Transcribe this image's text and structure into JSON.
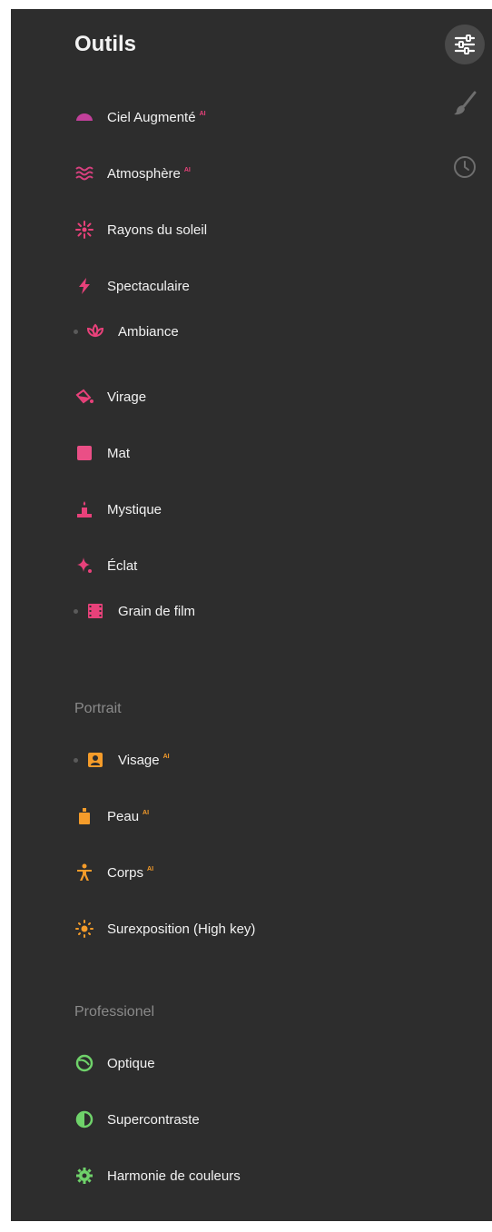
{
  "title": "Outils",
  "colors": {
    "panel_bg": "#2d2d2d",
    "creative": "#e8417a",
    "creative_purple": "#c2409a",
    "portrait": "#f59c2a",
    "professional": "#6fd26a",
    "ai_badge": "#e8417a",
    "sidebar_icon": "#6e6e6e"
  },
  "side_toolbar": [
    {
      "icon": "sliders-icon",
      "active": true
    },
    {
      "icon": "brush-icon",
      "active": false
    },
    {
      "icon": "history-clock-icon",
      "active": false
    }
  ],
  "creative_items": [
    {
      "label": "Ciel Augmenté",
      "ai": "AI",
      "icon": "sky-dome-icon"
    },
    {
      "label": "Atmosphère",
      "ai": "AI",
      "icon": "waves-icon"
    },
    {
      "label": "Rayons du soleil",
      "icon": "sun-rays-icon"
    },
    {
      "label": "Spectaculaire",
      "icon": "lightning-icon"
    },
    {
      "label": "Ambiance",
      "icon": "lotus-icon"
    },
    {
      "label": "Virage",
      "icon": "paint-bucket-icon"
    },
    {
      "label": "Mat",
      "icon": "square-icon"
    },
    {
      "label": "Mystique",
      "icon": "candle-icon"
    },
    {
      "label": "Éclat",
      "icon": "sparkle-icon"
    },
    {
      "label": "Grain de film",
      "icon": "film-icon"
    }
  ],
  "portrait_section": {
    "title": "Portrait",
    "items": [
      {
        "label": "Visage",
        "ai": "AI",
        "icon": "face-frame-icon"
      },
      {
        "label": "Peau",
        "ai": "AI",
        "icon": "bottle-icon"
      },
      {
        "label": "Corps",
        "ai": "AI",
        "icon": "person-icon"
      },
      {
        "label": "Surexposition (High key)",
        "icon": "sun-dashed-icon"
      }
    ]
  },
  "professional_section": {
    "title": "Professionel",
    "items": [
      {
        "label": "Optique",
        "icon": "lens-icon"
      },
      {
        "label": "Supercontraste",
        "icon": "contrast-icon"
      },
      {
        "label": "Harmonie de couleurs",
        "icon": "color-gear-icon"
      }
    ]
  }
}
